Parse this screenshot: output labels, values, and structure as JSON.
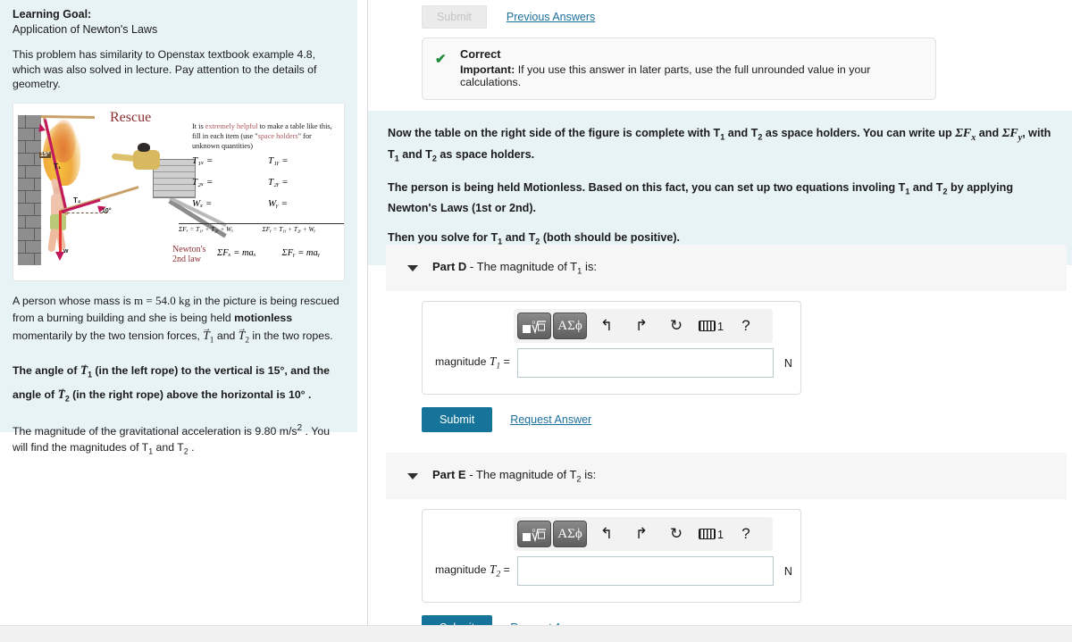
{
  "left": {
    "learning_goal_label": "Learning Goal:",
    "learning_goal_text": "Application of Newton's Laws",
    "intro": "This problem has similarity to Openstax textbook example 4.8, which was also solved in lecture. Pay attention to the details of geometry.",
    "figure": {
      "title": "Rescue",
      "note_line1": "It is ",
      "note_hl1": "extremely helpful",
      "note_line2": " to make a table like this, fill in each item (use \"",
      "note_hl2": "space holders",
      "note_line3": "\" for unknown quantities)",
      "table": [
        [
          "T₁ₓ =",
          "T₁ᵧ ="
        ],
        [
          "T₂ₓ =",
          "T₂ᵧ ="
        ],
        [
          "Wₓ =",
          "Wᵧ ="
        ]
      ],
      "sum_x": "ΣFₓ = T₁ₓ + T₂ₓ + Wₓ",
      "sum_y": "ΣFᵧ = T₁ᵧ + T₂ᵧ + Wᵧ",
      "newton_label_l1": "Newton's",
      "newton_label_l2": "2nd law",
      "law_x": "ΣFₓ = maₓ",
      "law_y": "ΣFᵧ = maᵧ",
      "angle_15": "15°",
      "angle_10": "10°",
      "label_t1": "T₁",
      "label_t2": "T₂",
      "label_w": "w"
    },
    "desc_a": "A person whose mass is ",
    "desc_mass": "m = 54.0 kg",
    "desc_b": " in the picture is being rescued from a burning building and she is being held ",
    "desc_motionless": "motionless",
    "desc_c": " momentarily by the two tension forces, ",
    "desc_T1": "T",
    "desc_T1sub": "1",
    "desc_and": " and ",
    "desc_T2": "T",
    "desc_T2sub": "2",
    "desc_d": " in the two ropes.",
    "angle_line_a": "The angle of ",
    "angle_line_b": " (in the left rope) to the vertical is 15°, and the angle of ",
    "angle_line_c": " (in the right rope) above the horizontal is 10° .",
    "grav_a": "The magnitude of the gravitational acceleration is 9.80 ",
    "grav_units": "m/s",
    "grav_exp": "2",
    "grav_b": " . You will find the magnitudes of T",
    "grav_t1sub": "1",
    "grav_c": " and T",
    "grav_t2sub": "2",
    "grav_d": " ."
  },
  "right": {
    "top_submit_label": "Submit",
    "previous_answers_label": "Previous Answers",
    "feedback": {
      "icon": "check-icon",
      "title": "Correct",
      "important_label": "Important:",
      "important_text": " If you use this answer in later parts, use the full unrounded value in your calculations."
    },
    "instructions": {
      "p1_a": "Now the table on the right side of the figure is complete with T",
      "p1_sub1": "1",
      "p1_b": " and T",
      "p1_sub2": "2",
      "p1_c": " as space holders. You can write up ",
      "p1_sigx": "ΣF",
      "p1_sigx_sub": "x",
      "p1_d": " and ",
      "p1_sigy": "ΣF",
      "p1_sigy_sub": "y",
      "p1_e": ", with T",
      "p1_sub3": "1",
      "p1_f": " and T",
      "p1_sub4": "2",
      "p1_g": " as space holders.",
      "p2_a": "The person is being held Motionless. Based on this fact, you can set up two equations involing T",
      "p2_sub1": "1",
      "p2_b": " and T",
      "p2_sub2": "2",
      "p2_c": " by applying Newton's Laws (1st or 2nd).",
      "p3_a": "Then you solve for T",
      "p3_sub1": "1",
      "p3_b": " and T",
      "p3_sub2": "2",
      "p3_c": "  (both should be positive)."
    },
    "parts": [
      {
        "id": "part-d",
        "name": "Part D",
        "separator": " - ",
        "title_a": "The magnitude of T",
        "title_sub": "1",
        "title_b": " is:",
        "answer_label_prefix": "magnitude ",
        "answer_label_var": "T",
        "answer_label_sub": "1",
        "answer_label_eq": "  =",
        "answer_value": "",
        "answer_placeholder": "",
        "unit": "N",
        "submit_label": "Submit",
        "request_answer_label": "Request Answer"
      },
      {
        "id": "part-e",
        "name": "Part E",
        "separator": " - ",
        "title_a": "The magnitude of T",
        "title_sub": "2",
        "title_b": " is:",
        "answer_label_prefix": "magnitude ",
        "answer_label_var": "T",
        "answer_label_sub": "2",
        "answer_label_eq": "  =",
        "answer_value": "",
        "answer_placeholder": "",
        "unit": "N",
        "submit_label": "Submit",
        "request_answer_label": "Request Answer"
      }
    ],
    "mathbar": {
      "template_button": "math-template-icon",
      "greek_button": "ΑΣϕ",
      "undo": "undo-icon",
      "redo": "redo-icon",
      "reset": "reset-icon",
      "keyboard": "keyboard-icon",
      "keyboard_count": "1",
      "help": "?"
    }
  },
  "colors": {
    "accent_blue": "#16749b",
    "panel_blue": "#e8f3f5",
    "link": "#1b6f9c",
    "correct_green": "#1f8a3b",
    "part_header_bg": "#f6f6f6"
  }
}
